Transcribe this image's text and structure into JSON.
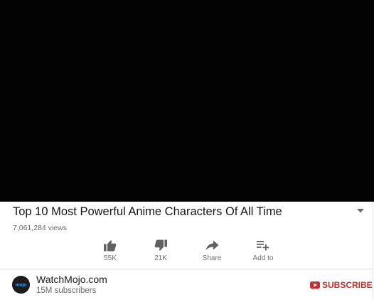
{
  "video": {
    "title": "Top 10 Most Powerful Anime Characters Of All Time",
    "views": "7,061,284 views"
  },
  "actions": [
    {
      "id": "like",
      "label": "55K",
      "icon": "thumbs-up-icon"
    },
    {
      "id": "dislike",
      "label": "21K",
      "icon": "thumbs-down-icon"
    },
    {
      "id": "share",
      "label": "Share",
      "icon": "share-icon"
    },
    {
      "id": "add",
      "label": "Add to",
      "icon": "playlist-add-icon"
    }
  ],
  "channel": {
    "name": "WatchMojo.com",
    "subscribers": "15M subscribers",
    "avatar_text": "mojo"
  },
  "subscribe": {
    "label": "SUBSCRIBE",
    "icon": "youtube-icon"
  },
  "colors": {
    "player_background": "#030303",
    "subscribe_red": "#c4302b",
    "secondary_text": "#6a6a6a"
  }
}
